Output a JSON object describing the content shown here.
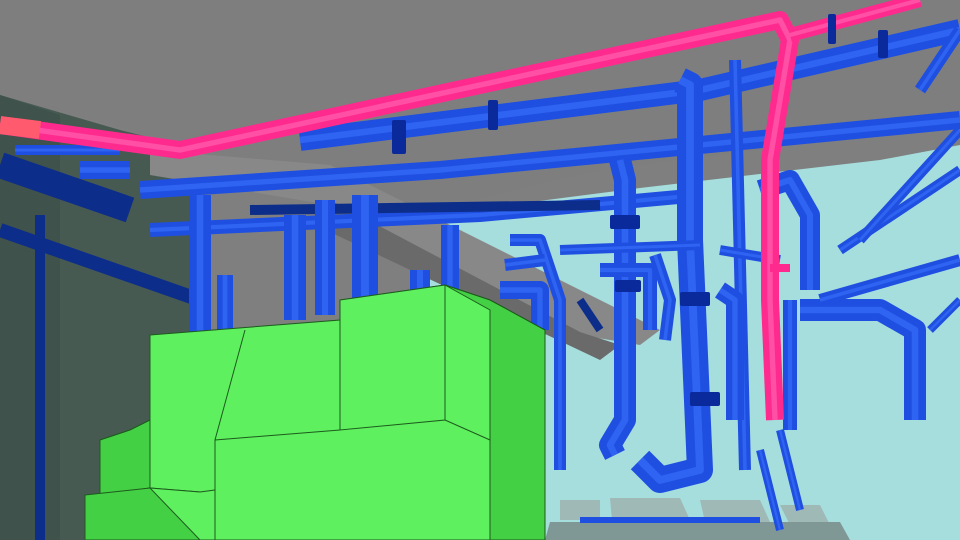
{
  "scene": {
    "colors": {
      "ceiling": "#7e7e7e",
      "ceiling_beam": "#888888",
      "back_wall": "#a6dede",
      "side_wall": "#465a52",
      "floor_slab": "#9fb9b6",
      "pipe_primary": "#1f4fe0",
      "pipe_highlight": "#3c74ff",
      "pipe_dark": "#0d2d8a",
      "pipe_flange": "#0a2a9c",
      "pipe_hot": "#ff2a8e",
      "pipe_hot_light": "#ff6fb8",
      "pipe_hot_end": "#ff5a6e",
      "equipment": "#5ef05e",
      "equipment_shade": "#44d044",
      "equipment_edge": "#1d5a1d"
    },
    "objects": [
      {
        "name": "ceiling-slab",
        "color": "ceiling"
      },
      {
        "name": "back-wall-panel",
        "color": "back_wall"
      },
      {
        "name": "left-side-wall",
        "color": "side_wall"
      },
      {
        "name": "overhead-beam",
        "color": "ceiling_beam"
      },
      {
        "name": "blue-pipe-network",
        "color": "pipe_primary"
      },
      {
        "name": "pink-pipe-run",
        "color": "pipe_hot"
      },
      {
        "name": "green-equipment-block",
        "color": "equipment"
      },
      {
        "name": "floor-slabs",
        "color": "floor_slab"
      }
    ]
  }
}
